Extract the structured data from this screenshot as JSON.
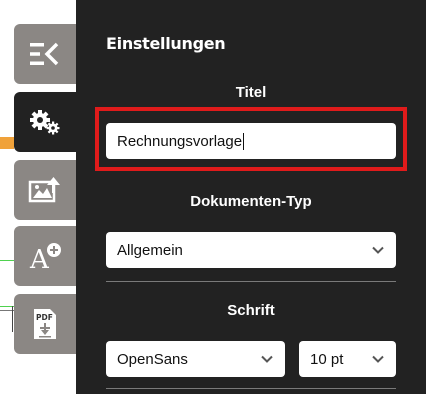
{
  "panel": {
    "title": "Einstellungen",
    "sections": {
      "title_label": "Titel",
      "doctype_label": "Dokumenten-Typ",
      "font_label": "Schrift"
    },
    "title_input_value": "Rechnungsvorlage",
    "doctype_selected": "Allgemein",
    "font_selected": "OpenSans",
    "font_size_selected": "10 pt"
  },
  "toolbar": {
    "tools": [
      {
        "icon": "collapse-panel-icon",
        "active": false
      },
      {
        "icon": "settings-gears-icon",
        "active": true
      },
      {
        "icon": "image-upload-icon",
        "active": false
      },
      {
        "icon": "add-text-icon",
        "active": false
      },
      {
        "icon": "pdf-download-icon",
        "active": false
      }
    ],
    "pdf_icon_text": "PDF"
  },
  "colors": {
    "panel_bg": "#222222",
    "tool_bg": "#8b8784",
    "highlight": "#e01b1b",
    "accent_orange": "#f0a23a"
  }
}
